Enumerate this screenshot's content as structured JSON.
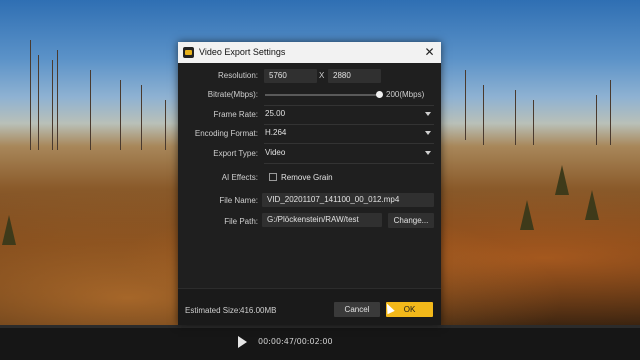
{
  "player": {
    "timecode": "00:00:47/00:02:00",
    "progress": 0.39
  },
  "dialog": {
    "title": "Video Export Settings",
    "resolution": {
      "label": "Resolution:",
      "width": "5760",
      "separator": "X",
      "height": "2880"
    },
    "bitrate": {
      "label": "Bitrate(Mbps):",
      "value_text": "200(Mbps)",
      "slider_fraction": 0.97
    },
    "frame_rate": {
      "label": "Frame Rate:",
      "value": "25.00"
    },
    "encoding_format": {
      "label": "Encoding Format:",
      "value": "H.264"
    },
    "export_type": {
      "label": "Export Type:",
      "value": "Video"
    },
    "ai_effects": {
      "label": "AI Effects:",
      "option_label": "Remove Grain",
      "checked": false
    },
    "file_name": {
      "label": "File Name:",
      "value": "VID_20201107_141100_00_012.mp4"
    },
    "file_path": {
      "label": "File Path:",
      "value": "G:/Plöckenstein/RAW/test",
      "change_label": "Change..."
    },
    "estimated_size": {
      "label": "Estimated Size:",
      "value": "416.00MB"
    },
    "cancel_label": "Cancel",
    "ok_label": "OK",
    "close_icon": "close-icon"
  },
  "colors": {
    "accent": "#f2b81a",
    "dialog_bg": "#1f1f1f",
    "titlebar_bg": "#f2f2f2"
  }
}
